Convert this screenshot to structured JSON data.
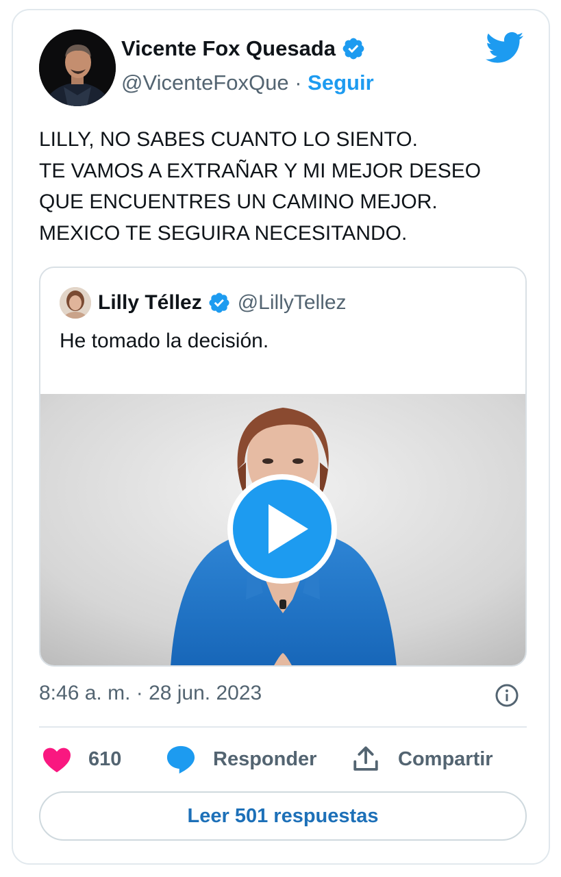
{
  "author": {
    "name": "Vicente Fox Quesada",
    "handle": "@VicenteFoxQue",
    "separator": "·",
    "follow_label": "Seguir",
    "verified_icon": "verified-badge-icon",
    "platform_icon": "twitter-bird-icon"
  },
  "tweet": {
    "lines": [
      "LILLY, NO SABES CUANTO LO SIENTO.",
      "TE VAMOS A EXTRAÑAR Y MI MEJOR DESEO",
      "QUE ENCUENTRES UN CAMINO MEJOR.",
      "MEXICO TE SEGUIRA NECESITANDO."
    ]
  },
  "quoted": {
    "name": "Lilly Téllez",
    "handle": "@LillyTellez",
    "text": "He tomado la decisión.",
    "media": "video",
    "play_icon": "play-icon"
  },
  "timestamp": "8:46 a. m. · 28 jun. 2023",
  "actions": {
    "likes": "610",
    "reply_label": "Responder",
    "share_label": "Compartir"
  },
  "read_replies_label": "Leer 501 respuestas",
  "colors": {
    "brand": "#1d9bf0",
    "like": "#f91880",
    "reply_icon": "#1d9bf0",
    "read_replies_text": "#1d70b8",
    "secondary_text": "#536471"
  }
}
